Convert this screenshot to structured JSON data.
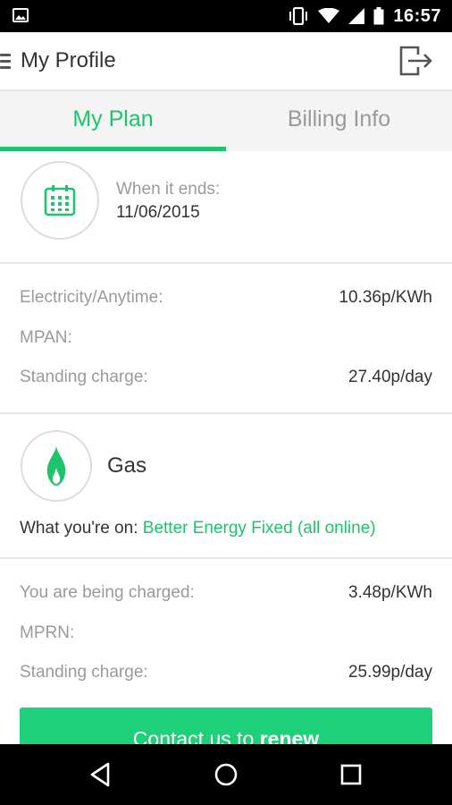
{
  "status_bar": {
    "time": "16:57",
    "icons": [
      "image-notification-icon",
      "vibrate-icon",
      "wifi-icon",
      "signal-icon",
      "battery-icon"
    ]
  },
  "app_bar": {
    "title": "My Profile",
    "menu_icon": "hamburger-menu-icon",
    "action_icon": "logout-icon"
  },
  "tabs": [
    {
      "label": "My Plan",
      "active": true
    },
    {
      "label": "Billing Info",
      "active": false
    }
  ],
  "plan_end": {
    "icon": "calendar-icon",
    "label": "When it ends:",
    "date": "11/06/2015"
  },
  "electricity": {
    "rate_label": "Electricity/Anytime:",
    "rate_value": "10.36p/KWh",
    "mpan_label": "MPAN:",
    "standing_label": "Standing charge:",
    "standing_value": "27.40p/day"
  },
  "gas": {
    "icon": "flame-icon",
    "title": "Gas",
    "on_label": "What you're on:",
    "plan_name": "Better Energy Fixed (all online)",
    "rate_label": "You are being charged:",
    "rate_value": "3.48p/KWh",
    "mprn_label": "MPRN:",
    "standing_label": "Standing charge:",
    "standing_value": "25.99p/day"
  },
  "renew_button": {
    "prefix": "Contact us to",
    "bold": "renew"
  },
  "colors": {
    "accent": "#1ec46c",
    "button": "#1ed07a",
    "muted_text": "#9a9a9a",
    "divider": "#e6e6e6"
  }
}
